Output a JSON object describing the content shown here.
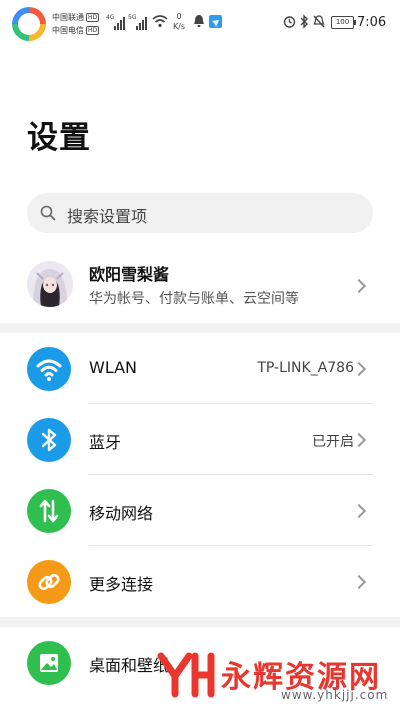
{
  "status_bar": {
    "carrier1": "中国联通",
    "carrier2": "中国电信",
    "hd": "HD",
    "net1": "4G",
    "net2": "5G",
    "speed_value": "0",
    "speed_unit": "K/s",
    "battery": "100",
    "time": "7:06"
  },
  "header": {
    "title": "设置",
    "search_placeholder": "搜索设置项"
  },
  "profile": {
    "name": "欧阳雪梨酱",
    "subtitle": "华为帐号、付款与账单、云空间等"
  },
  "settings_items": [
    {
      "label": "WLAN",
      "value": "TP-LINK_A786",
      "icon": "wifi-icon",
      "color": "#1a9be8"
    },
    {
      "label": "蓝牙",
      "value": "已开启",
      "icon": "bluetooth-icon",
      "color": "#1a9be8"
    },
    {
      "label": "移动网络",
      "value": "",
      "icon": "mobile-data-icon",
      "color": "#2fbf4f"
    },
    {
      "label": "更多连接",
      "value": "",
      "icon": "link-icon",
      "color": "#f59a16"
    },
    {
      "label": "桌面和壁纸",
      "value": "",
      "icon": "wallpaper-icon",
      "color": "#2fbf4f"
    }
  ],
  "watermark": {
    "text": "永辉资源网",
    "url": "www.yhkjjj.com"
  }
}
